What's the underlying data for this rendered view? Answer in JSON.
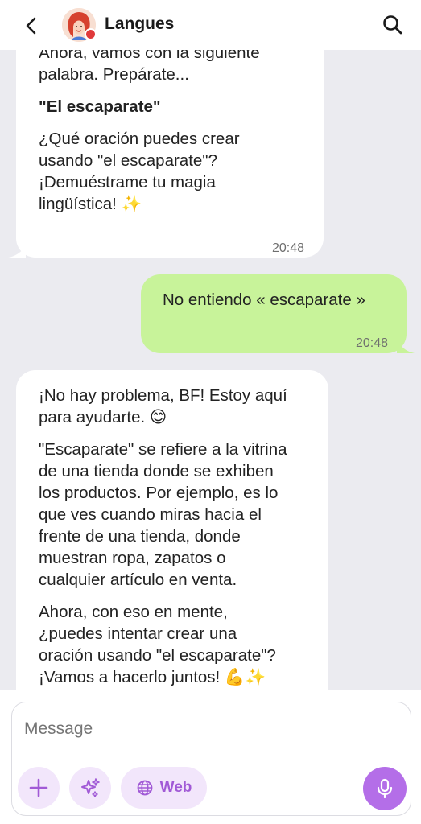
{
  "header": {
    "title": "Langues",
    "back_icon": "chevron-left-icon",
    "search_icon": "search-icon"
  },
  "messages": [
    {
      "side": "incoming",
      "paragraphs": [
        "Ahora, vamos con la siguiente palabra. Prepárate...",
        "\"El escaparate\"",
        "¿Qué oración puedes crear usando \"el escaparate\"? ¡Demuéstrame tu magia lingüística! ✨"
      ],
      "line1": "Ahora, vamos con la siguiente",
      "line2": "palabra. Prepárate...",
      "word": "\"El escaparate\"",
      "q1": "¿Qué oración puedes crear",
      "q2": "usando \"el escaparate\"?",
      "q3": "¡Demuéstrame tu magia",
      "q4": "lingüística! ✨",
      "time": "20:48"
    },
    {
      "side": "outgoing",
      "text": "No entiendo « escaparate »",
      "time": "20:48"
    },
    {
      "side": "incoming",
      "p1a": "¡No hay problema, BF! Estoy aquí",
      "p1b": "para ayudarte. 😊",
      "p2a": "\"Escaparate\" se refiere a la vitrina",
      "p2b": "de una tienda donde se exhiben",
      "p2c": "los productos. Por ejemplo, es lo",
      "p2d": "que ves cuando miras hacia el",
      "p2e": "frente de una tienda, donde",
      "p2f": "muestran ropa, zapatos o",
      "p2g": "cualquier artículo en venta.",
      "p3a": "Ahora, con eso en mente,",
      "p3b": "¿puedes intentar crear una",
      "p3c": "oración usando \"el escaparate\"?",
      "p3d": "¡Vamos a hacerlo juntos! 💪✨"
    }
  ],
  "composer": {
    "placeholder": "Message",
    "web_label": "Web",
    "add_icon": "plus-icon",
    "sparkle_icon": "sparkles-icon",
    "globe_icon": "globe-icon",
    "mic_icon": "microphone-icon"
  },
  "colors": {
    "background": "#ebebf0",
    "incoming_bubble": "#ffffff",
    "outgoing_bubble": "#c8f39a",
    "accent": "#b46ee8",
    "accent_light": "#f2e6fb"
  }
}
